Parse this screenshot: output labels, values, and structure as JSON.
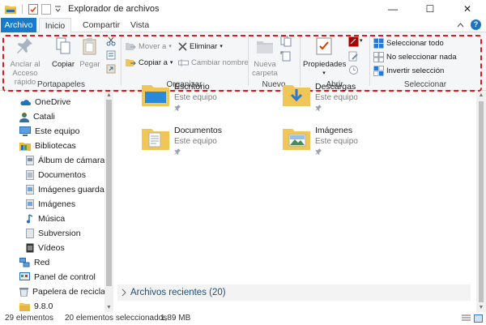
{
  "window": {
    "title": "Explorador de archivos",
    "minimize": "—",
    "maximize": "☐",
    "close": "✕"
  },
  "tabs": {
    "file": "Archivo",
    "home": "Inicio",
    "share": "Compartir",
    "view": "Vista",
    "help": "?"
  },
  "ribbon": {
    "clipboard": {
      "label": "Portapapeles",
      "pin_line1": "Anclar al",
      "pin_line2": "Acceso rápido",
      "copy": "Copiar",
      "paste": "Pegar"
    },
    "organize": {
      "label": "Organizar",
      "move_to": "Mover a",
      "copy_to": "Copiar a",
      "delete": "Eliminar",
      "rename": "Cambiar nombre"
    },
    "new": {
      "label": "Nuevo",
      "new_folder_line1": "Nueva",
      "new_folder_line2": "carpeta"
    },
    "open": {
      "label": "Abrir",
      "properties": "Propiedades"
    },
    "select": {
      "label": "Seleccionar",
      "select_all": "Seleccionar todo",
      "select_none": "No seleccionar nada",
      "invert": "Invertir selección"
    }
  },
  "nav": {
    "items": [
      {
        "label": "OneDrive",
        "icon": "cloud-icon"
      },
      {
        "label": "Catali",
        "icon": "user-icon"
      },
      {
        "label": "Este equipo",
        "icon": "computer-icon"
      },
      {
        "label": "Bibliotecas",
        "icon": "library-icon"
      },
      {
        "label": "Álbum de cámara",
        "icon": "folder-icon"
      },
      {
        "label": "Documentos",
        "icon": "folder-icon"
      },
      {
        "label": "Imágenes guardadas",
        "icon": "folder-icon"
      },
      {
        "label": "Imágenes",
        "icon": "folder-icon"
      },
      {
        "label": "Música",
        "icon": "music-icon"
      },
      {
        "label": "Subversion",
        "icon": "folder-icon"
      },
      {
        "label": "Vídeos",
        "icon": "video-icon"
      },
      {
        "label": "Red",
        "icon": "network-icon"
      },
      {
        "label": "Panel de control",
        "icon": "control-panel-icon"
      },
      {
        "label": "Papelera de reciclaje",
        "icon": "recycle-bin-icon"
      },
      {
        "label": "9.8.0",
        "icon": "folder-icon"
      }
    ]
  },
  "content": {
    "folders": [
      {
        "name": "Escritorio",
        "sub": "Este equipo"
      },
      {
        "name": "Descargas",
        "sub": "Este equipo"
      },
      {
        "name": "Documentos",
        "sub": "Este equipo"
      },
      {
        "name": "Imágenes",
        "sub": "Este equipo"
      }
    ],
    "recent": "Archivos recientes (20)"
  },
  "status": {
    "count": "29 elementos",
    "selected": "20 elementos seleccionados",
    "size": "1,89 MB"
  },
  "colors": {
    "accent": "#1979ca",
    "highlight_outline": "#e01818",
    "folder": "#f0c659"
  }
}
